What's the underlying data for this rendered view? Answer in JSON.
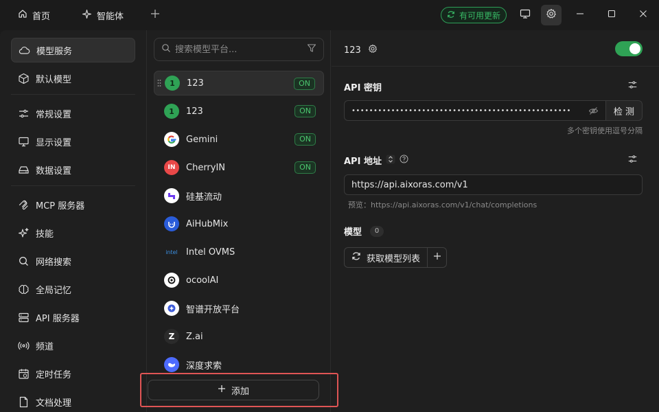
{
  "titlebar": {
    "tabs": [
      {
        "label": "首页",
        "icon": "home-icon"
      },
      {
        "label": "智能体",
        "icon": "sparkle-icon"
      }
    ],
    "update_label": "有可用更新"
  },
  "nav": {
    "items": [
      {
        "label": "模型服务",
        "icon": "cloud-icon",
        "active": true
      },
      {
        "label": "默认模型",
        "icon": "cube-icon"
      },
      {
        "label": "常规设置",
        "icon": "sliders-icon"
      },
      {
        "label": "显示设置",
        "icon": "monitor-icon"
      },
      {
        "label": "数据设置",
        "icon": "hard-drive-icon"
      },
      {
        "label": "MCP 服务器",
        "icon": "mcp-icon"
      },
      {
        "label": "技能",
        "icon": "sparkles-icon"
      },
      {
        "label": "网络搜索",
        "icon": "search-icon"
      },
      {
        "label": "全局记忆",
        "icon": "brain-icon"
      },
      {
        "label": "API 服务器",
        "icon": "server-icon"
      },
      {
        "label": "频道",
        "icon": "broadcast-icon"
      },
      {
        "label": "定时任务",
        "icon": "calendar-icon"
      },
      {
        "label": "文档处理",
        "icon": "document-icon"
      }
    ]
  },
  "providers": {
    "search_placeholder": "搜索模型平台...",
    "items": [
      {
        "name": "123",
        "logo_text": "1",
        "on": "ON",
        "active": true
      },
      {
        "name": "123",
        "logo_text": "1",
        "on": "ON"
      },
      {
        "name": "Gemini",
        "logo_text": "G",
        "on": "ON"
      },
      {
        "name": "CherryIN",
        "logo_text": "IN",
        "on": "ON"
      },
      {
        "name": "硅基流动",
        "logo_text": ""
      },
      {
        "name": "AiHubMix",
        "logo_text": ""
      },
      {
        "name": "Intel OVMS",
        "logo_text": "intel"
      },
      {
        "name": "ocoolAI",
        "logo_text": ""
      },
      {
        "name": "智谱开放平台",
        "logo_text": ""
      },
      {
        "name": "Z.ai",
        "logo_text": "Z"
      },
      {
        "name": "深度求索",
        "logo_text": ""
      }
    ],
    "add_label": "添加"
  },
  "detail": {
    "provider_name": "123",
    "enabled": true,
    "api_key": {
      "title": "API 密钥",
      "value": "••••••••••••••••••••••••••••••••••••••••••••••••••",
      "check_label": "检 测",
      "hint": "多个密钥使用逗号分隔"
    },
    "api_url": {
      "title": "API 地址",
      "value": "https://api.aixoras.com/v1",
      "preview": "预览：https://api.aixoras.com/v1/chat/completions"
    },
    "models": {
      "title": "模型",
      "count": "0",
      "fetch_label": "获取模型列表"
    }
  },
  "colors": {
    "accent_green": "#2fa255",
    "highlight_border": "#e05555"
  }
}
